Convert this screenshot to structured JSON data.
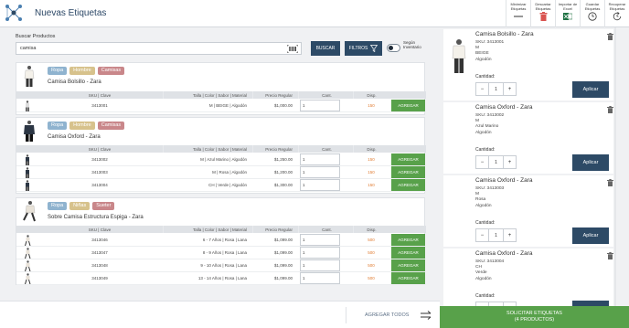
{
  "app": {
    "title": "Nuevas Etiquetas"
  },
  "toolbar": [
    {
      "label": "Minimizar Etiquetas",
      "icon": "minimize-icon"
    },
    {
      "label": "Descartar Etiquetas",
      "icon": "trash-icon"
    },
    {
      "label": "Importar de Excel",
      "icon": "excel-icon"
    },
    {
      "label": "Guardar Etiquetas",
      "icon": "clock-icon"
    },
    {
      "label": "Recuperar Etiquetas",
      "icon": "restore-icon"
    }
  ],
  "search": {
    "label": "Buscar Productos",
    "value": "camisa",
    "buscar_label": "BUSCAR",
    "filtros_label": "FILTROS",
    "toggle_label": "Según Inventario"
  },
  "table_headers": {
    "sku": "SKU | Clave",
    "talla": "Talla | Color | Sabor | Material",
    "precio": "Precio Regular",
    "cant": "Cant.",
    "disp": "Disp."
  },
  "agregar_label": "AGREGAR",
  "products": [
    {
      "tags": [
        "Ropa",
        "Hombre",
        "Camisas"
      ],
      "name": "Camisa Bolsillo - Zara",
      "rows": [
        {
          "sku": "3413001",
          "talla": "M | BEIGE | Algodón",
          "precio": "$1,000.00",
          "cant": "1",
          "disp": "150"
        }
      ]
    },
    {
      "tags": [
        "Ropa",
        "Hombre",
        "Camisas"
      ],
      "name": "Camisa Oxford - Zara",
      "rows": [
        {
          "sku": "3413002",
          "talla": "M | Azul Marino | Algodón",
          "precio": "$1,250.00",
          "cant": "1",
          "disp": "150"
        },
        {
          "sku": "3413003",
          "talla": "M | Rosa | Algodón",
          "precio": "$1,200.00",
          "cant": "1",
          "disp": "150"
        },
        {
          "sku": "3413004",
          "talla": "CH | Verde | Algodón",
          "precio": "$1,300.00",
          "cant": "1",
          "disp": "150"
        }
      ]
    },
    {
      "tags": [
        "Ropa",
        "Niñas",
        "Sueter"
      ],
      "name": "Sobre Camisa Estructura Espiga - Zara",
      "rows": [
        {
          "sku": "3413046",
          "talla": "6 - 7 Años | Rosa | Lana",
          "precio": "$1,099.00",
          "cant": "1",
          "disp": "500"
        },
        {
          "sku": "3413047",
          "talla": "8 - 9 Años | Rosa | Lana",
          "precio": "$1,099.00",
          "cant": "1",
          "disp": "500"
        },
        {
          "sku": "3413048",
          "talla": "9 - 10 Años | Rosa | Lana",
          "precio": "$1,099.00",
          "cant": "1",
          "disp": "500"
        },
        {
          "sku": "3413049",
          "talla": "13 - 14 Años | Rosa | Lana",
          "precio": "$1,099.00",
          "cant": "1",
          "disp": "500"
        }
      ]
    }
  ],
  "footer": {
    "agregar_todos": "AGREGAR TODOS"
  },
  "cart": {
    "cantidad_label": "Cantidad:",
    "aplicar_label": "Aplicar",
    "items": [
      {
        "title": "Camisa Bolsillo - Zara",
        "sku": "SKU: 3413001",
        "talla": "M",
        "color": "BEIGE",
        "material": "Algodón",
        "qty": "1"
      },
      {
        "title": "Camisa Oxford - Zara",
        "sku": "SKU: 3413002",
        "talla": "M",
        "color": "Azul Marino",
        "material": "Algodón",
        "qty": "1"
      },
      {
        "title": "Camisa Oxford - Zara",
        "sku": "SKU: 3413003",
        "talla": "M",
        "color": "Rosa",
        "material": "Algodón",
        "qty": "1"
      },
      {
        "title": "Camisa Oxford - Zara",
        "sku": "SKU: 3413004",
        "talla": "CH",
        "color": "Verde",
        "material": "Algodón",
        "qty": "1"
      }
    ],
    "solicitar_line1": "SOLICITAR ETIQUETAS",
    "solicitar_line2": "(4 PRODUCTOS)"
  },
  "colors": {
    "primary": "#2d4a66",
    "success": "#58a14a",
    "availability": "#e07a2e",
    "trash": "#d9534f"
  }
}
